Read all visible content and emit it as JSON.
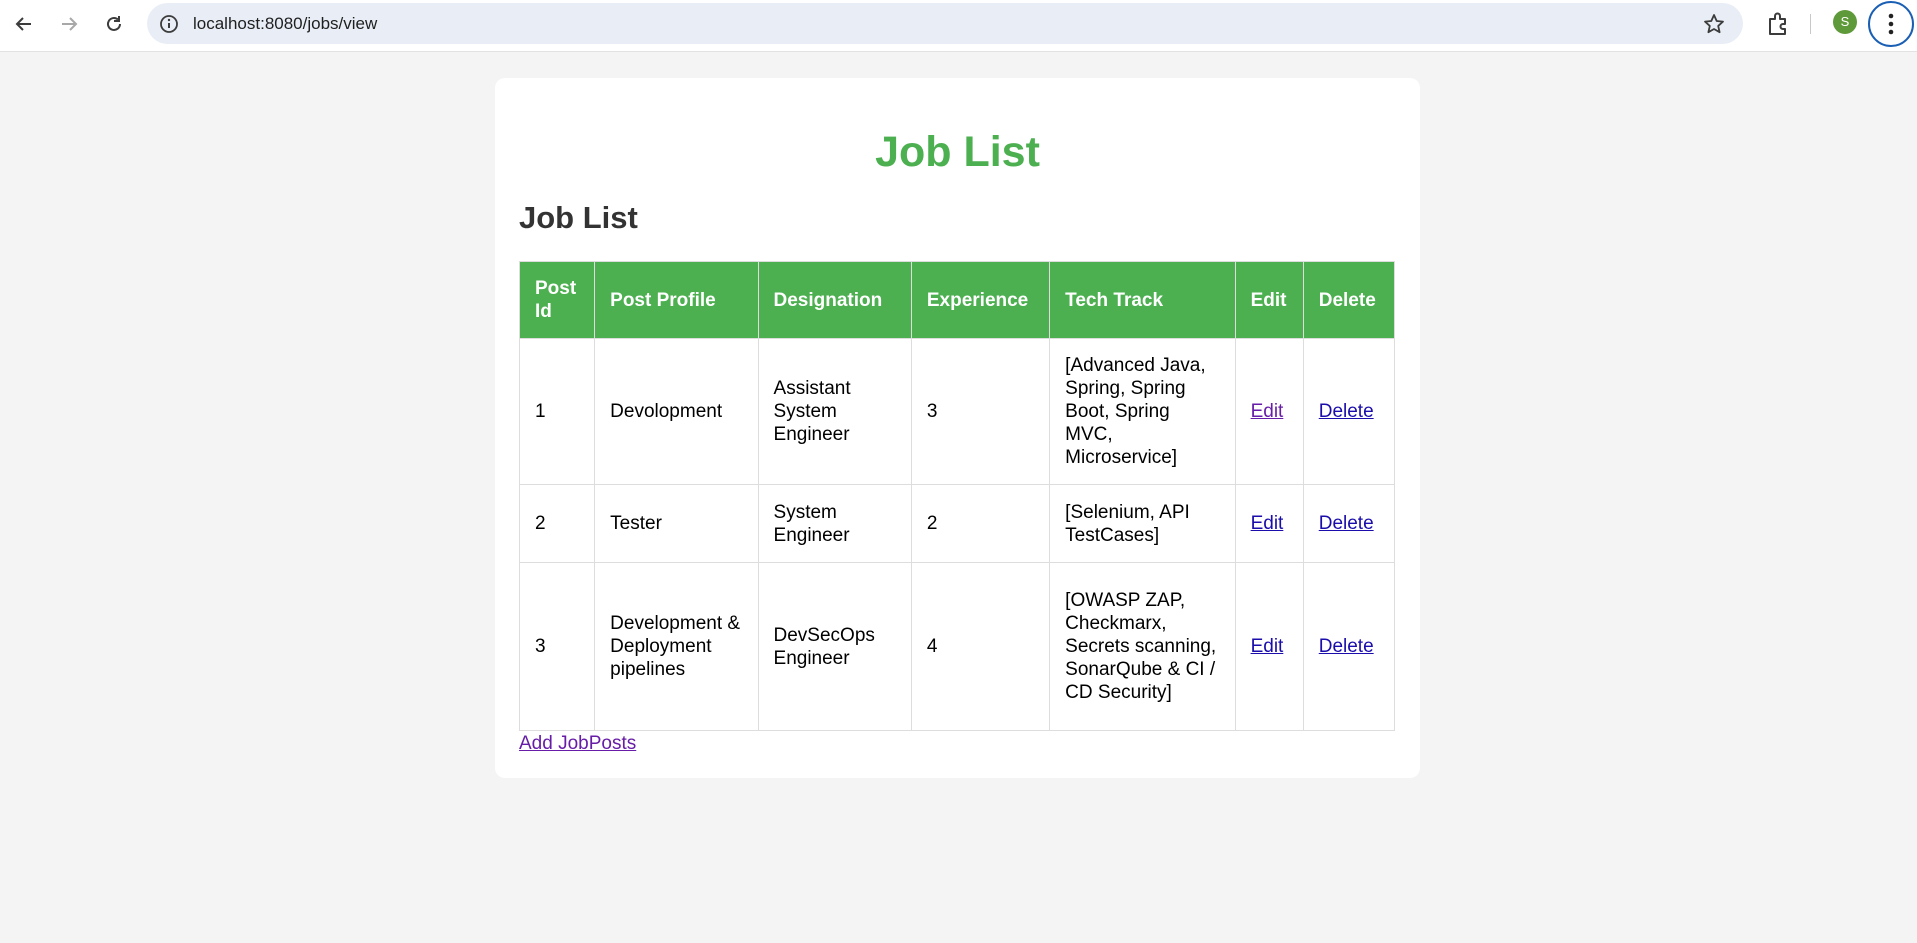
{
  "browser": {
    "url": "localhost:8080/jobs/view",
    "avatar_letter": "S"
  },
  "page": {
    "main_title": "Job List",
    "sub_title": "Job List",
    "add_link": "Add JobPosts"
  },
  "table": {
    "headers": [
      "Post Id",
      "Post Profile",
      "Designation",
      "Experience",
      "Tech Track",
      "Edit",
      "Delete"
    ],
    "rows": [
      {
        "id": "1",
        "profile": "Devolopment",
        "designation": "Assistant System Engineer",
        "experience": "3",
        "tech": "[Advanced Java, Spring, Spring Boot, Spring MVC, Microservice]",
        "edit": "Edit",
        "delete": "Delete"
      },
      {
        "id": "2",
        "profile": "Tester",
        "designation": "System Engineer",
        "experience": "2",
        "tech": "[Selenium, API TestCases]",
        "edit": "Edit",
        "delete": "Delete"
      },
      {
        "id": "3",
        "profile": "Development & Deployment pipelines",
        "designation": "DevSecOps Engineer",
        "experience": "4",
        "tech": "[OWASP ZAP, Checkmarx, Secrets scanning, SonarQube & CI / CD Security]",
        "edit": "Edit",
        "delete": "Delete"
      }
    ]
  },
  "colors": {
    "accent": "#4caf50",
    "background": "#f4f4f4",
    "link": "#1a0dab",
    "visited_link": "#681da8"
  }
}
